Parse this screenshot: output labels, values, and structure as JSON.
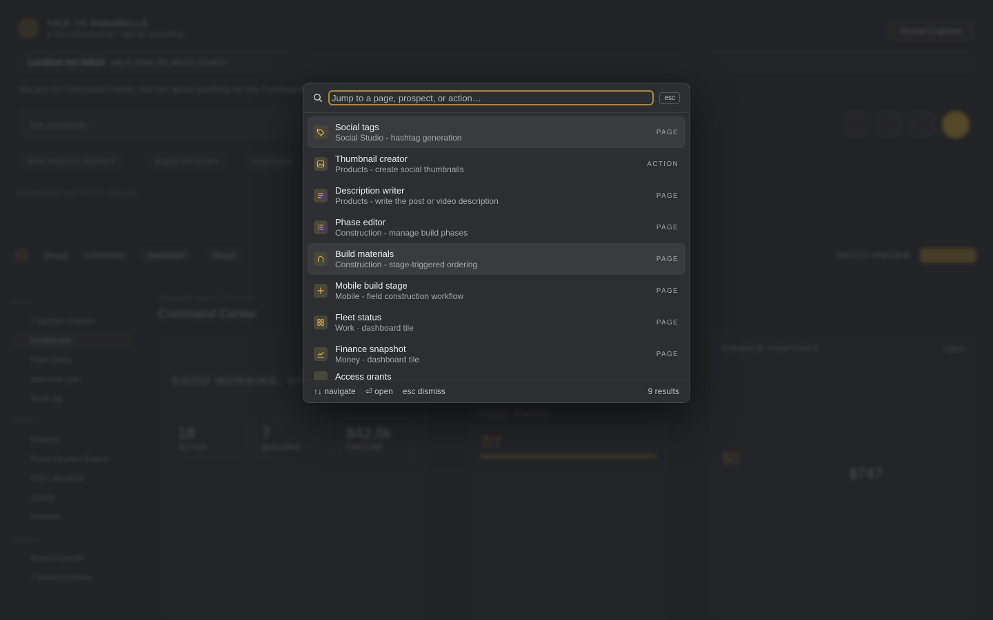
{
  "background": {
    "header_title": "TALK TO ANNABELLE",
    "header_sub": "● Not connected yet · ask her something",
    "prompt_button": "Prompt Engineer",
    "location_bold": "Location not linked",
    "location_rest": "· tap to share the device location",
    "intro_line": "You are on Command Center. Ask her about anything on this Command",
    "ask_placeholder": "Ask Annabelle…",
    "chips": [
      "What needs my attention?",
      "Explain this screen",
      "Summarize"
    ],
    "small_label": "RESPONSE OUTPUTS ONLINE",
    "nav_brand": "Stingar",
    "nav_brand_sub": "COMMAND",
    "nav_pills": [
      "Dashboard",
      "Stingar"
    ],
    "nav_right": [
      "SWITCH",
      "PREVIEW"
    ],
    "sidebar": [
      {
        "head": "WORK",
        "items": [
          "Cognition degeee",
          "Dashboard",
          "Fleet status",
          "Approval gate",
          "Audit log"
        ]
      },
      {
        "head": "MONEY",
        "items": [
          "Finance",
          "Retail Quarter Report",
          "ROI Calculator",
          "Grants",
          "Rebates"
        ]
      },
      {
        "head": "PEOPLE",
        "items": [
          "Wound benefit",
          "Communications"
        ]
      }
    ],
    "main_crumb": "Combined · Aug 31, 07:41 UTC",
    "main_title": "Command Center",
    "greeting": "GOOD MORNING, VIVI",
    "stats": [
      {
        "value": "18",
        "label": "ACTIVE"
      },
      {
        "value": "7",
        "label": "BUILDING"
      },
      {
        "value": "$42.8k",
        "label": "PIPELINE"
      }
    ],
    "fleet_card_title": "FLEET STATUS",
    "fleet_value": "7/7",
    "finance_card_title": "FINANCE SNAPSHOT",
    "finance_mrr": "$0",
    "finance_net": "$747",
    "open_label": "Open"
  },
  "palette": {
    "search_placeholder": "Jump to a page, prospect, or action…",
    "esc_label": "esc",
    "results": [
      {
        "title": "Social tags",
        "subtitle": "Social Studio - hashtag generation",
        "kind": "PAGE",
        "icon": "tag-icon"
      },
      {
        "title": "Thumbnail creator",
        "subtitle": "Products - create social thumbnails",
        "kind": "ACTION",
        "icon": "image-icon"
      },
      {
        "title": "Description writer",
        "subtitle": "Products - write the post or video description",
        "kind": "PAGE",
        "icon": "text-lines-icon"
      },
      {
        "title": "Phase editor",
        "subtitle": "Construction - manage build phases",
        "kind": "PAGE",
        "icon": "list-icon"
      },
      {
        "title": "Build materials",
        "subtitle": "Construction - stage-triggered ordering",
        "kind": "PAGE",
        "icon": "arch-icon"
      },
      {
        "title": "Mobile build stage",
        "subtitle": "Mobile - field construction workflow",
        "kind": "PAGE",
        "icon": "plus-icon"
      },
      {
        "title": "Fleet status",
        "subtitle": "Work · dashboard tile",
        "kind": "PAGE",
        "icon": "grid-icon"
      },
      {
        "title": "Finance snapshot",
        "subtitle": "Money · dashboard tile",
        "kind": "PAGE",
        "icon": "chart-line-icon"
      },
      {
        "title": "Access grants",
        "subtitle": "",
        "kind": "",
        "icon": "key-icon"
      }
    ],
    "footer": {
      "navigate": "↑↓ navigate",
      "open": "⏎ open",
      "dismiss": "esc dismiss",
      "count": "9 results"
    },
    "accent_color": "#a58b45"
  }
}
